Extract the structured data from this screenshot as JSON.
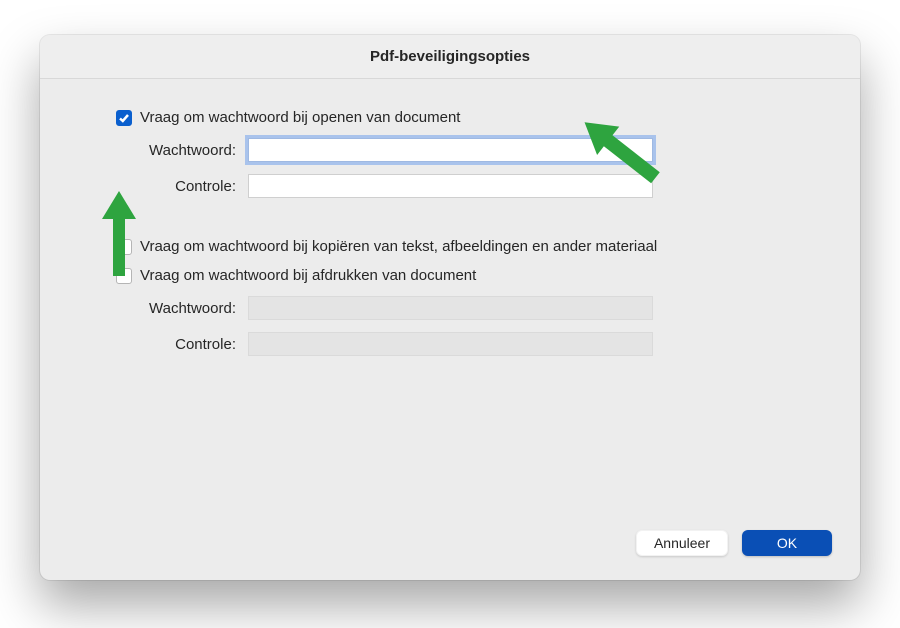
{
  "window": {
    "title": "Pdf-beveiligingsopties"
  },
  "section_open": {
    "checkbox_label": "Vraag om wachtwoord bij openen van document",
    "password_label": "Wachtwoord:",
    "verify_label": "Controle:",
    "password_value": "",
    "verify_value": ""
  },
  "section_perm": {
    "copy_checkbox_label": "Vraag om wachtwoord bij kopiëren van tekst, afbeeldingen en ander materiaal",
    "print_checkbox_label": "Vraag om wachtwoord bij afdrukken van document",
    "password_label": "Wachtwoord:",
    "verify_label": "Controle:"
  },
  "footer": {
    "cancel": "Annuleer",
    "ok": "OK"
  },
  "annotations": {
    "arrow_color": "#2ea43f"
  }
}
